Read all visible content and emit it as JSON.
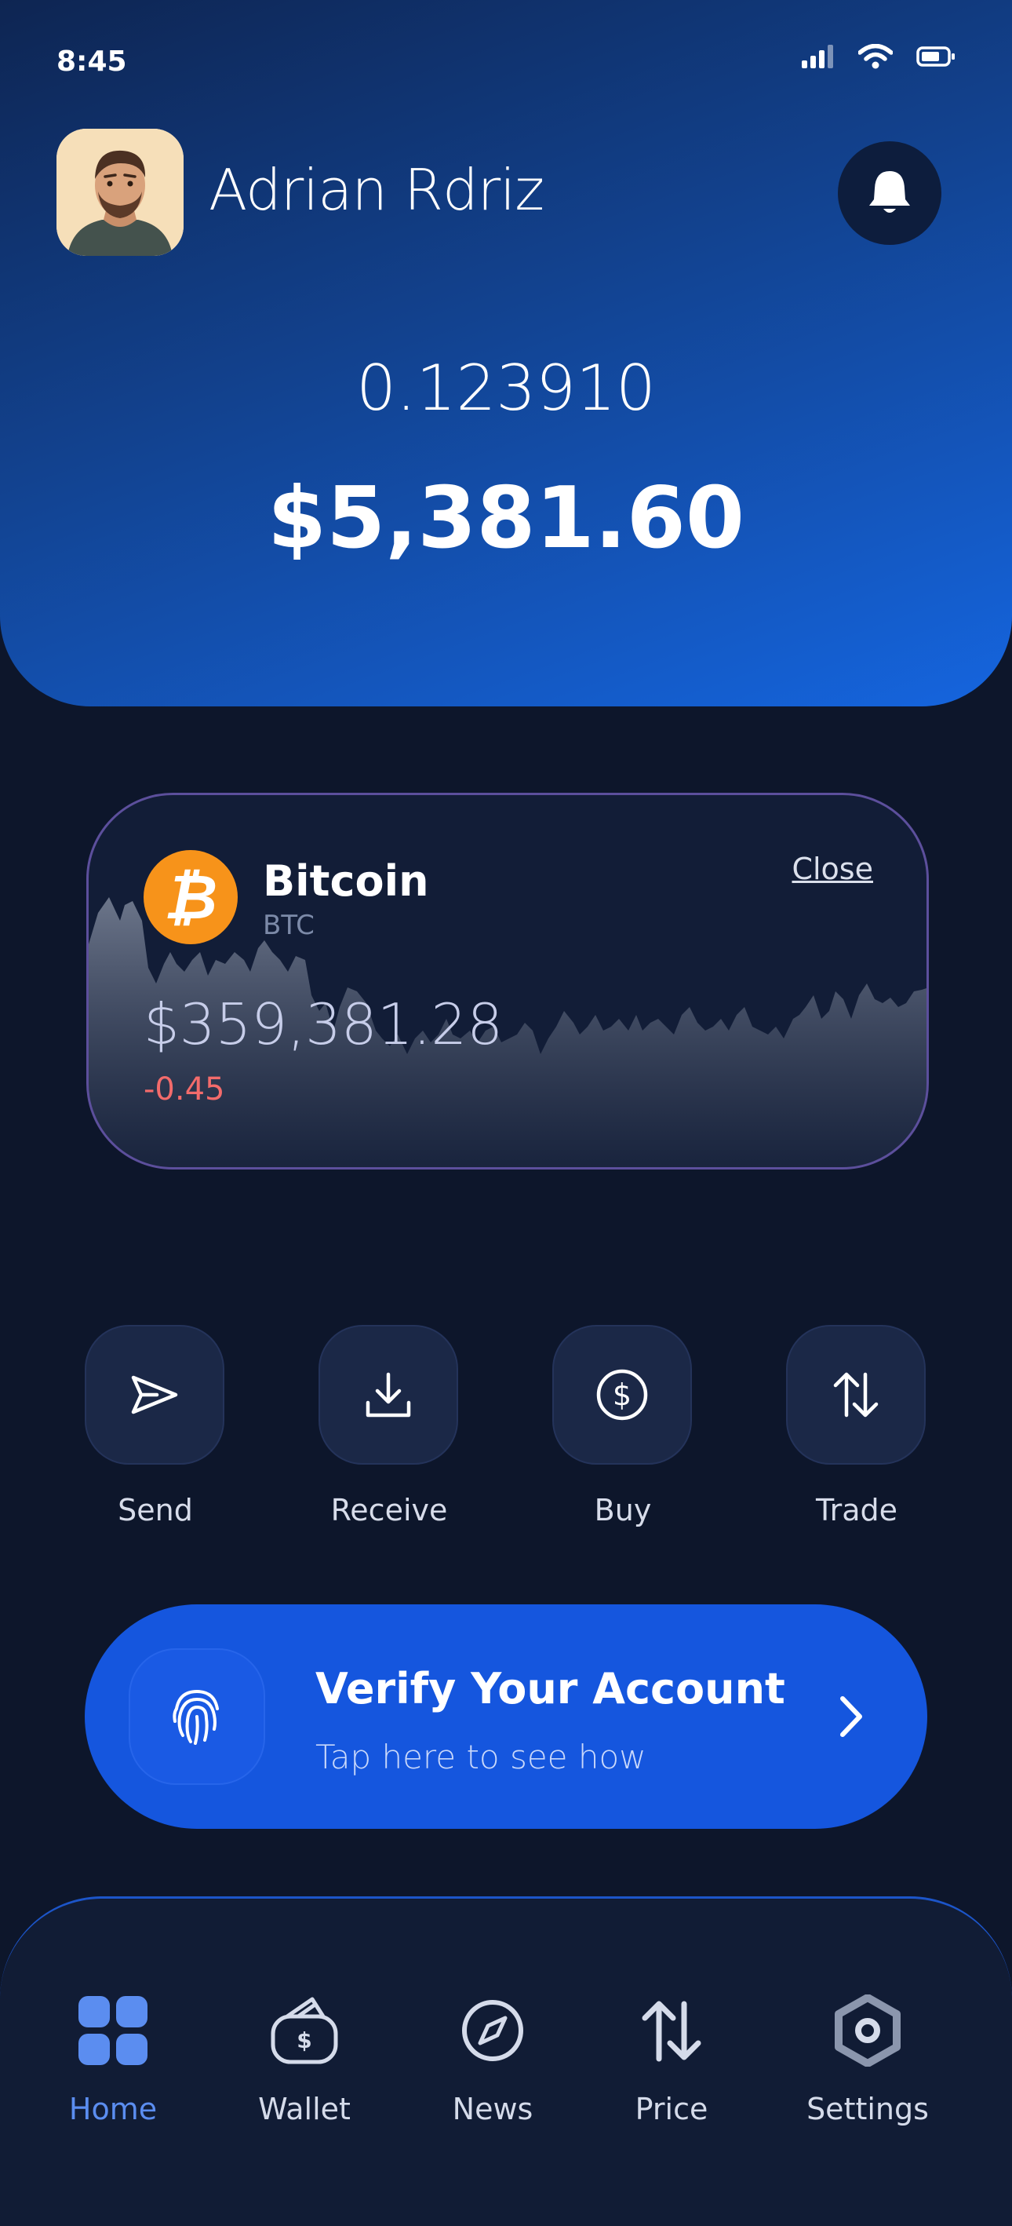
{
  "status_bar": {
    "time": "8:45"
  },
  "profile": {
    "name": "Adrian Rdriz"
  },
  "balance": {
    "crypto": "0.123910",
    "fiat": "$5,381.60"
  },
  "coin_card": {
    "name": "Bitcoin",
    "symbol": "BTC",
    "logo_glyph": "₿",
    "price": "$359,381.28",
    "change": "-0.45",
    "close_label": "Close",
    "colors": {
      "logo": "#f7931a",
      "change": "#f36b6b",
      "border": "#5c4f9c"
    }
  },
  "actions": [
    {
      "label": "Send",
      "icon": "send-icon"
    },
    {
      "label": "Receive",
      "icon": "download-icon"
    },
    {
      "label": "Buy",
      "icon": "dollar-coin-icon"
    },
    {
      "label": "Trade",
      "icon": "swap-arrows-icon"
    }
  ],
  "verify_banner": {
    "title": "Verify Your Account",
    "subtitle": "Tap here to see how",
    "icon": "fingerprint-icon",
    "color": "#1556de"
  },
  "bottom_nav": {
    "active": "Home",
    "items": [
      {
        "label": "Home",
        "icon": "grid-icon"
      },
      {
        "label": "Wallet",
        "icon": "wallet-icon"
      },
      {
        "label": "News",
        "icon": "compass-icon"
      },
      {
        "label": "Price",
        "icon": "swap-arrows-icon"
      },
      {
        "label": "Settings",
        "icon": "hexagon-gear-icon"
      }
    ],
    "active_color": "#5b8df0"
  }
}
